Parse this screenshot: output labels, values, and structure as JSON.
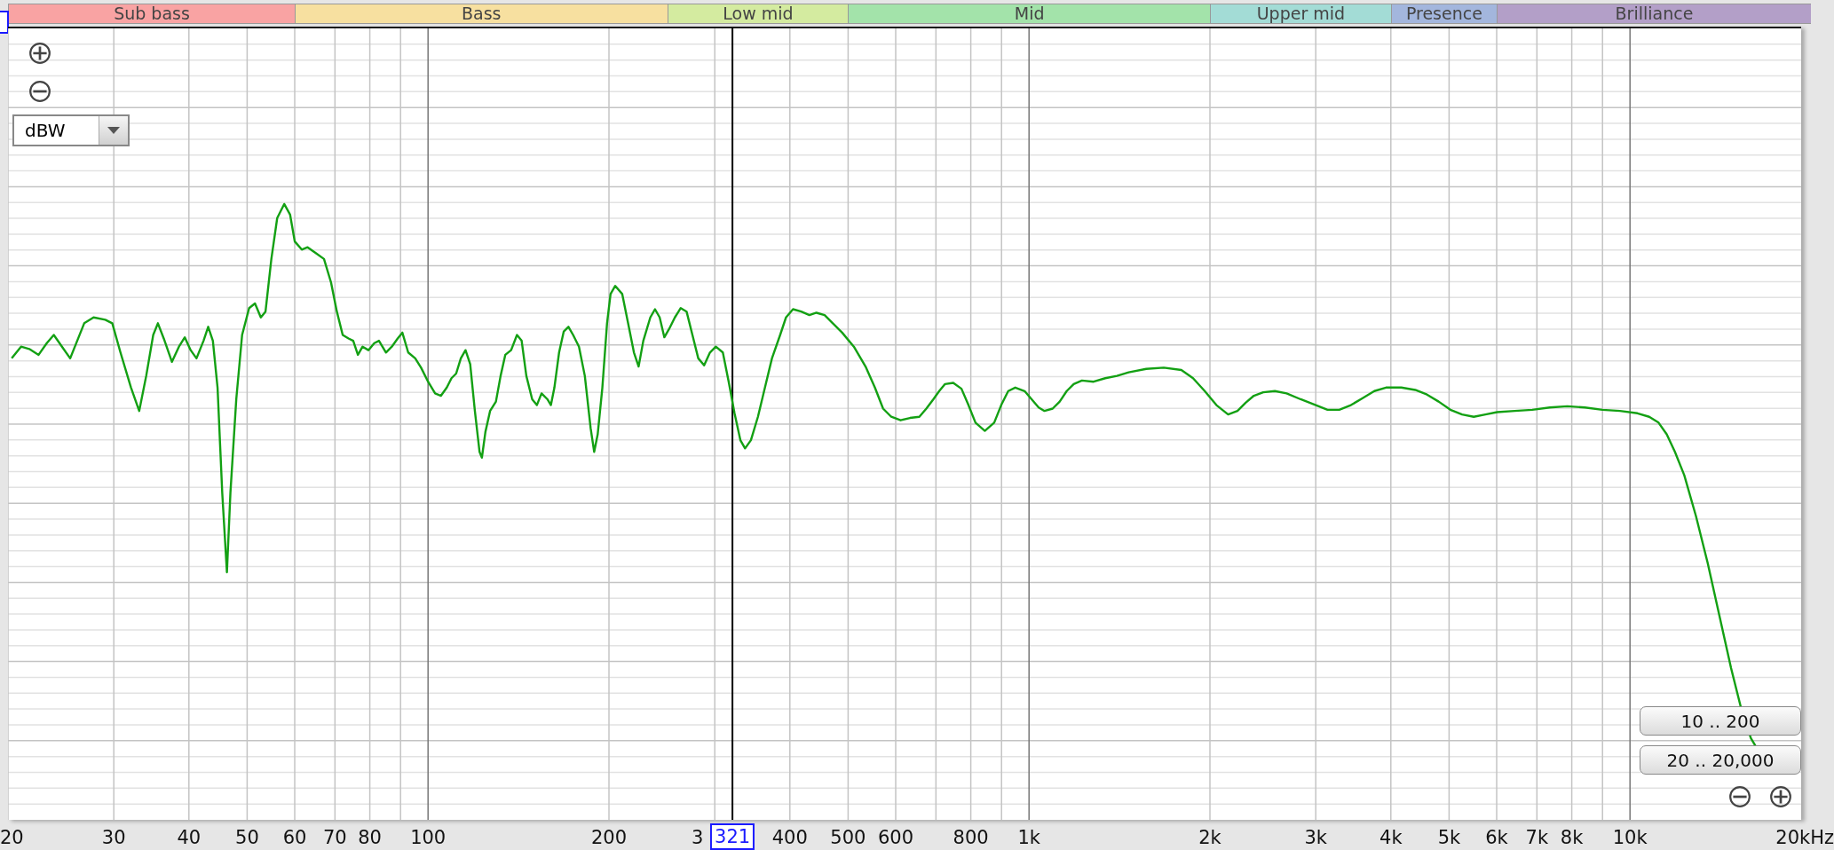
{
  "bands": [
    {
      "label": "Sub bass",
      "color": "#f9a3a3"
    },
    {
      "label": "Bass",
      "color": "#f7e0a0"
    },
    {
      "label": "Low mid",
      "color": "#d4eba0"
    },
    {
      "label": "Mid",
      "color": "#a3e3aa"
    },
    {
      "label": "Upper mid",
      "color": "#a3dcd6"
    },
    {
      "label": "Presence",
      "color": "#a3b6dd"
    },
    {
      "label": "Brilliance",
      "color": "#b39fc8"
    }
  ],
  "unit_dropdown": {
    "value": "dBW"
  },
  "range_buttons": [
    "10 .. 200",
    "20 .. 20,000"
  ],
  "x_axis": {
    "ticks": [
      "20",
      "30",
      "40",
      "50",
      "60",
      "70",
      "80",
      "100",
      "200",
      "3",
      "400",
      "500",
      "600",
      "800",
      "1k",
      "2k",
      "3k",
      "4k",
      "5k",
      "6k",
      "7k",
      "8k",
      "10k",
      "20kHz"
    ]
  },
  "cursor": {
    "readout": "321"
  }
}
